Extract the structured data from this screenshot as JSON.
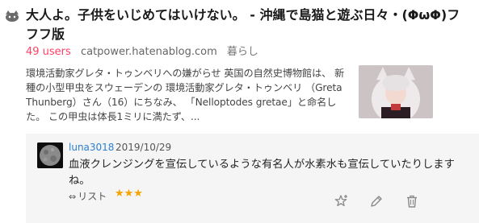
{
  "entry": {
    "title": "大人よ。子供をいじめてはいけない。 - 沖縄で島猫と遊ぶ日々・(ΦωΦ)フフフ版",
    "users": "49 users",
    "domain": "catpower.hatenablog.com",
    "category": "暮らし",
    "summary": "環境活動家グレタ・トゥンベリへの嫌がらせ 英国の自然史博物館は、 新種の小型甲虫をスウェーデンの 環境活動家グレタ・トゥンベリ （Greta Thunberg）さん（16）にちなみ、 「Nelloptodes gretae」と命名した。 この甲虫は体長1ミリに満たず、..."
  },
  "comment": {
    "user": "luna3018",
    "date": "2019/10/29",
    "text": "血液クレンジングを宣伝しているような有名人が水素水も宣伝していたりしますね。",
    "list_label": "リスト",
    "stars": "★★★"
  },
  "icons": {
    "entry": "cat-face-icon",
    "list": "link-icon",
    "add_star": "add-star-icon",
    "edit": "pencil-icon",
    "delete": "trash-icon"
  },
  "colors": {
    "users": "#ff4166",
    "username": "#2b7fd1",
    "star": "#f4a300",
    "comment_bg": "#f5f5f5"
  }
}
